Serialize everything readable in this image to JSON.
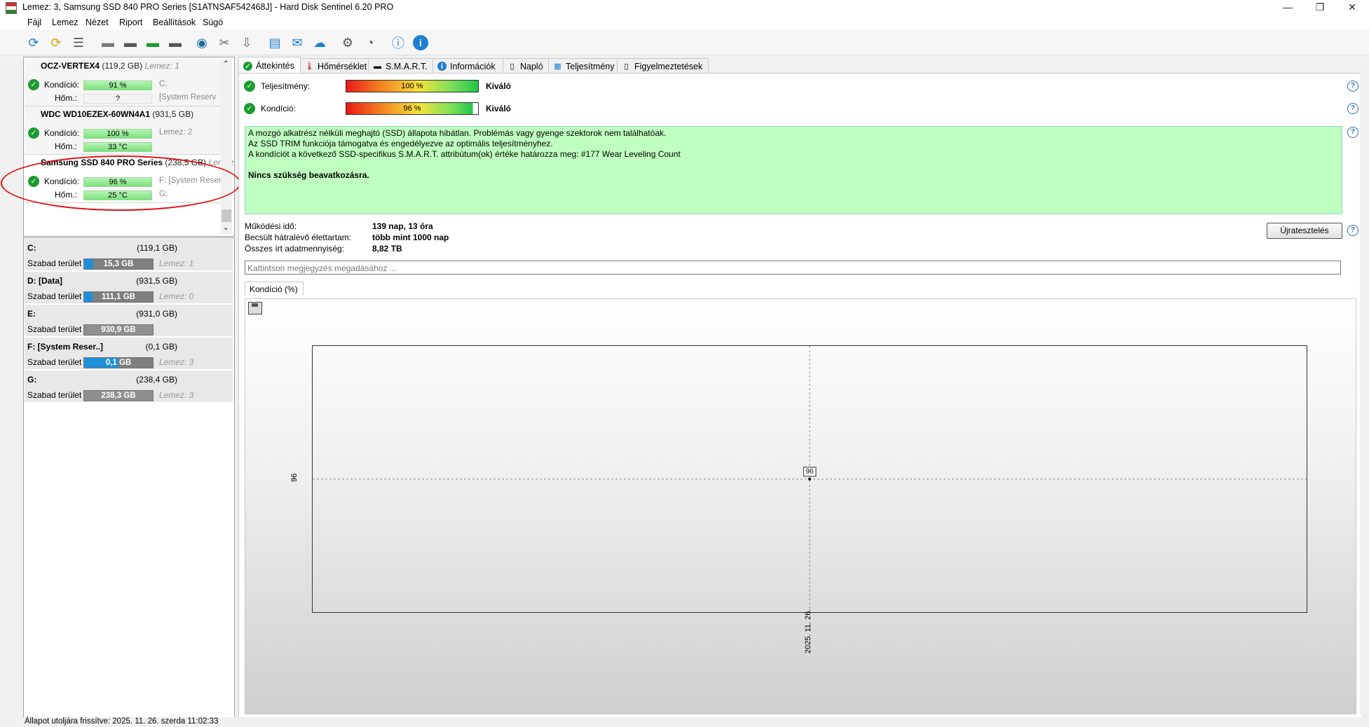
{
  "window": {
    "title": "Lemez: 3, Samsung SSD 840 PRO Series [S1ATNSAF542468J]  -  Hard Disk Sentinel 6.20 PRO",
    "min": "—",
    "max": "❐",
    "close": "✕"
  },
  "menu": [
    "Fájl",
    "Lemez",
    "Nézet",
    "Riport",
    "Beállítások",
    "Súgó"
  ],
  "toolbar": {
    "icons": [
      "refresh-icon",
      "refresh-warning-icon",
      "disk-list-icon",
      "disk-gray-icon",
      "disk-schedule-icon",
      "disk-check-icon",
      "disk-search-icon",
      "disk-network-icon",
      "disk-tools-icon",
      "disk-export-icon",
      "report-icon",
      "email-icon",
      "network-icon",
      "settings-icon",
      "sound-icon",
      "help-icon",
      "info-icon"
    ]
  },
  "disks": [
    {
      "name": "OCZ-VERTEX4",
      "size": "(119,2 GB)",
      "ref": "Lemez: 1",
      "cond_label": "Kondíció:",
      "cond": "91 %",
      "cond_pct": 91,
      "temp_label": "Hőm.:",
      "temp": "?",
      "extra1": "C:",
      "extra2": "[System Reserv"
    },
    {
      "name": "WDC WD10EZEX-60WN4A1",
      "size": "(931,5 GB)",
      "ref": "Lemez: 2",
      "cond_label": "Kondíció:",
      "cond": "100 %",
      "cond_pct": 100,
      "temp_label": "Hőm.:",
      "temp": "33 °C",
      "extra1": "",
      "extra2": ""
    },
    {
      "name": "Samsung SSD 840 PRO Series",
      "size": "(238,5 GB)",
      "ref": "Lemez",
      "cond_label": "Kondíció:",
      "cond": "96 %",
      "cond_pct": 96,
      "temp_label": "Hőm.:",
      "temp": "25 °C",
      "extra1": "F: [System Reserv",
      "extra2": "G:"
    }
  ],
  "volumes": [
    {
      "name": "C:",
      "size": "(119,1 GB)",
      "free_label": "Szabad terület",
      "free": "15,3 GB",
      "free_pct": 13,
      "ref": "Lemez: 1"
    },
    {
      "name": "D: [Data]",
      "size": "(931,5 GB)",
      "free_label": "Szabad terület",
      "free": "111,1 GB",
      "free_pct": 12,
      "ref": "Lemez: 0"
    },
    {
      "name": "E:",
      "size": "(931,0 GB)",
      "free_label": "Szabad terület",
      "free": "930,9 GB",
      "free_pct": 100,
      "ref": ""
    },
    {
      "name": "F: [System Reser..]",
      "size": "(0,1 GB)",
      "free_label": "Szabad terület",
      "free": "0,1 GB",
      "free_pct": 50,
      "ref": "Lemez: 3"
    },
    {
      "name": "G:",
      "size": "(238,4 GB)",
      "free_label": "Szabad terület",
      "free": "238,3 GB",
      "free_pct": 100,
      "ref": "Lemez: 3"
    }
  ],
  "tabs": [
    "Áttekintés",
    "Hőmérséklet",
    "S.M.A.R.T.",
    "Információk",
    "Napló",
    "Teljesítmény",
    "Figyelmeztetések"
  ],
  "overview": {
    "perf_label": "Teljesítmény:",
    "perf_value": "100 %",
    "perf_pct": 100,
    "perf_rating": "Kiváló",
    "cond_label": "Kondíció:",
    "cond_value": "96 %",
    "cond_pct": 96,
    "cond_rating": "Kiváló",
    "message": [
      "A mozgó alkatrész nélküli meghajtó (SSD) állapota hibátlan. Problémás vagy gyenge szektorok nem találhatóak.",
      "Az SSD TRIM funkciója támogatva és engedélyezve az optimális teljesítményhez.",
      "A kondíciót a következő SSD-specifikus S.M.A.R.T. attribútum(ok) értéke határozza meg:  #177 Wear Leveling Count"
    ],
    "action": "Nincs szükség beavatkozásra.",
    "uptime_label": "Működési idő:",
    "uptime": "139 nap, 13 óra",
    "remaining_label": "Becsült hátralévő élettartam:",
    "remaining": "több mint 1000 nap",
    "written_label": "Összes írt adatmennyiség:",
    "written": "8,82 TB",
    "retest_button": "Újratesztelés",
    "note_placeholder": "Kattintson megjegyzés megadásához ...",
    "chart_tab": "Kondíció  (%)",
    "help": "?"
  },
  "chart_data": {
    "type": "line",
    "x": [
      "2025. 11. 26."
    ],
    "series": [
      {
        "values": [
          96
        ]
      }
    ],
    "y_tick": "96",
    "data_label": "96",
    "grid": true
  },
  "status": "Állapot utoljára frissítve: 2025. 11. 26. szerda 11:02:33",
  "colors": {
    "ok": "#1a9b2e",
    "message_bg": "#bfffbf",
    "volume_fill": "#1e8fd8",
    "annotation": "#dd1111"
  }
}
